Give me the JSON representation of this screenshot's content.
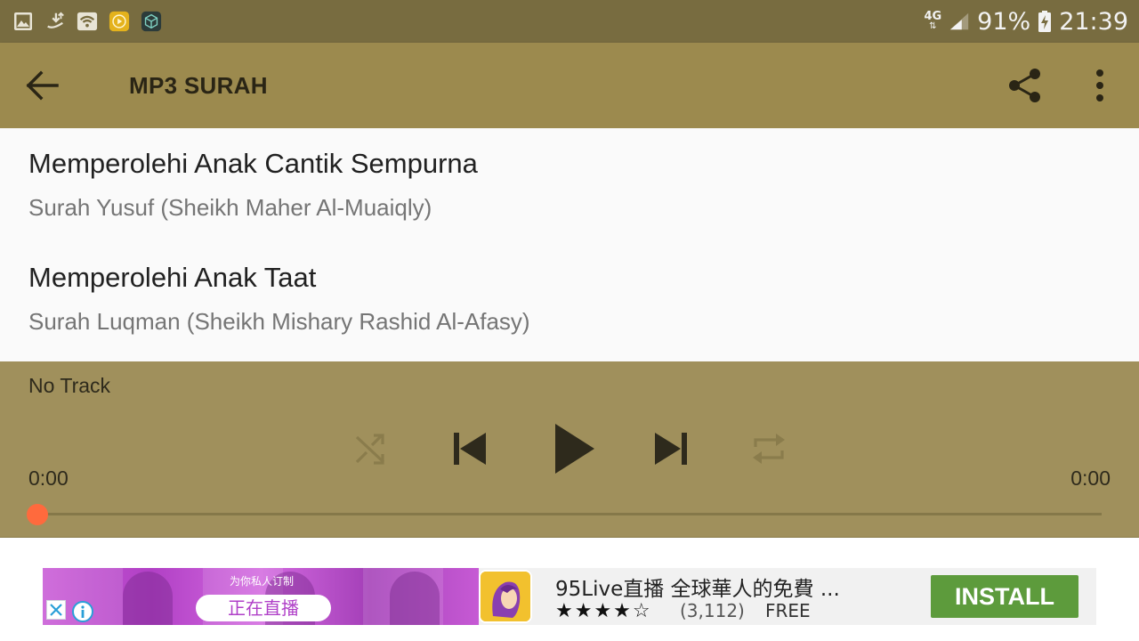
{
  "status_bar": {
    "network": "4G",
    "battery": "91%",
    "time": "21:39",
    "left_icons": [
      "gallery-icon",
      "download-icon",
      "wifi-icon",
      "play-app-icon",
      "cube-app-icon"
    ]
  },
  "toolbar": {
    "title": "MP3 SURAH",
    "back_icon": "arrow-left-icon",
    "share_icon": "share-icon",
    "more_icon": "more-vert-icon"
  },
  "list": {
    "items": [
      {
        "title": "Memperolehi Anak Cantik Sempurna",
        "subtitle": "Surah Yusuf (Sheikh Maher Al-Muaiqly)"
      },
      {
        "title": "Memperolehi Anak Taat",
        "subtitle": "Surah Luqman (Sheikh Mishary Rashid Al-Afasy)"
      }
    ]
  },
  "player": {
    "track": "No Track",
    "elapsed": "0:00",
    "duration": "0:00",
    "progress": 0,
    "controls": [
      "shuffle-icon",
      "skip-previous-icon",
      "play-icon",
      "skip-next-icon",
      "repeat-icon"
    ]
  },
  "ad": {
    "tagline": "为你私人订制",
    "live_label": "正在直播",
    "app_name": "95Live直播 全球華人的免費 ...",
    "rating_stars": "★★★★☆",
    "rating": 4,
    "rating_count": "(3,112)",
    "price": "FREE",
    "install_label": "INSTALL"
  },
  "colors": {
    "status_bar": "#786c40",
    "toolbar": "#9c8a4e",
    "player": "#a0905c",
    "seek_accent": "#ff6a3d",
    "install_button": "#5d9b3c"
  }
}
